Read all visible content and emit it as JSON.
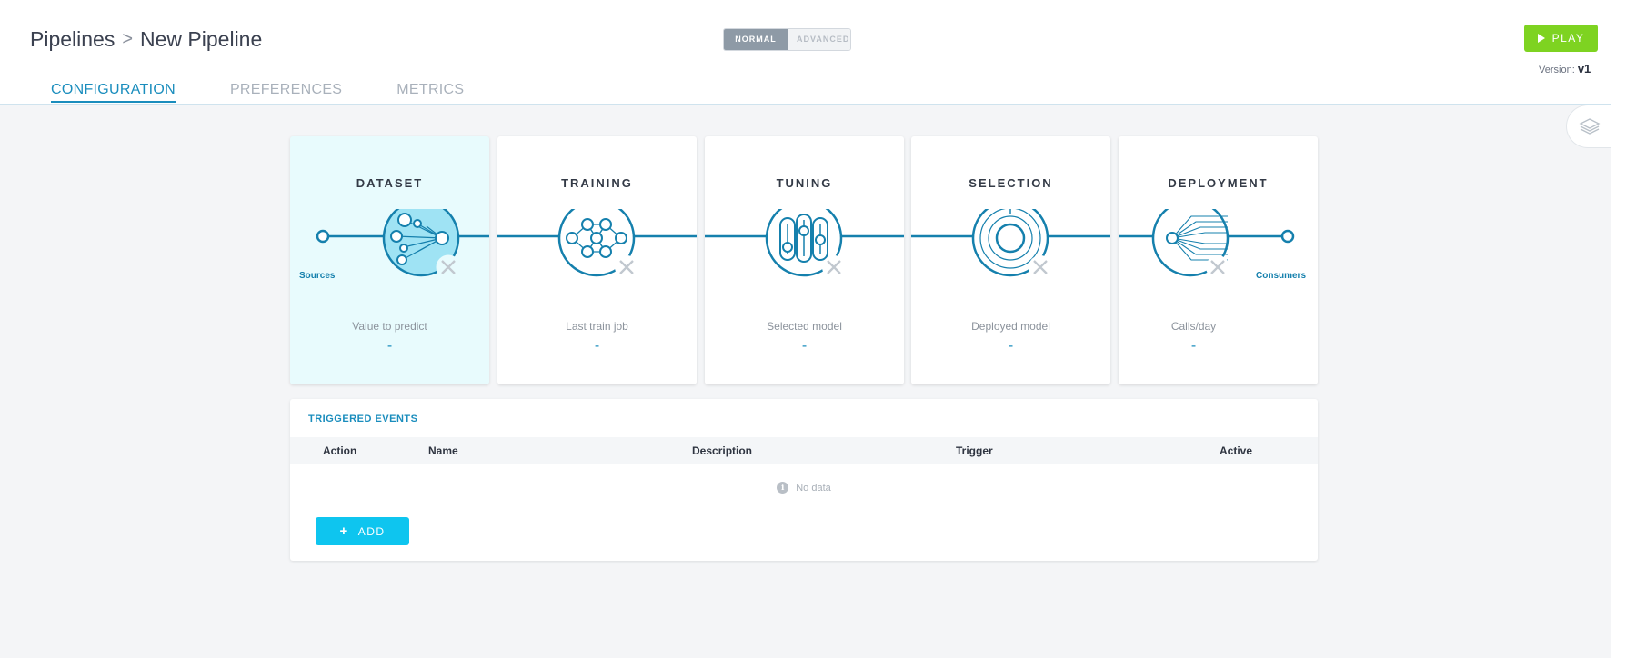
{
  "header": {
    "breadcrumb": {
      "parent": "Pipelines",
      "separator": ">",
      "current": "New Pipeline"
    },
    "mode_toggle": {
      "normal": "NORMAL",
      "advanced": "ADVANCED",
      "selected": "NORMAL"
    },
    "play_label": "PLAY",
    "version_label": "Version:",
    "version_value": "v1",
    "tabs": [
      {
        "label": "CONFIGURATION",
        "active": true
      },
      {
        "label": "PREFERENCES",
        "active": false
      },
      {
        "label": "METRICS",
        "active": false
      }
    ]
  },
  "pipeline": {
    "start_label": "Sources",
    "end_label": "Consumers",
    "steps": [
      {
        "title": "DATASET",
        "subtitle": "Value to predict",
        "value": "-",
        "active": true
      },
      {
        "title": "TRAINING",
        "subtitle": "Last train job",
        "value": "-",
        "active": false
      },
      {
        "title": "TUNING",
        "subtitle": "Selected model",
        "value": "-",
        "active": false
      },
      {
        "title": "SELECTION",
        "subtitle": "Deployed model",
        "value": "-",
        "active": false
      },
      {
        "title": "DEPLOYMENT",
        "subtitle": "Calls/day",
        "value": "-",
        "active": false
      }
    ]
  },
  "events": {
    "title": "TRIGGERED EVENTS",
    "columns": [
      "Action",
      "Name",
      "Description",
      "Trigger",
      "Active"
    ],
    "rows": [],
    "empty_text": "No data",
    "add_label": "ADD"
  },
  "colors": {
    "accent": "#1a8dbd",
    "play": "#7ed321",
    "add": "#0ec5ef",
    "active_step_bg": "#e8fbfd"
  }
}
